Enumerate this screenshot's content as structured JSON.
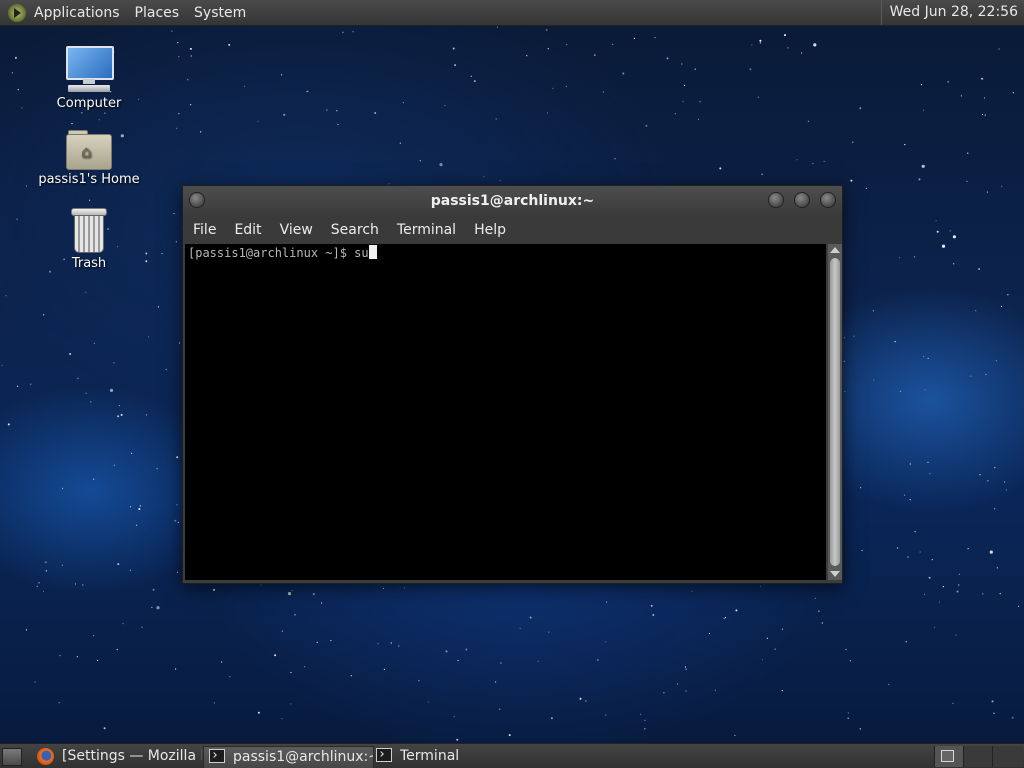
{
  "top_panel": {
    "menus": [
      "Applications",
      "Places",
      "System"
    ],
    "clock": "Wed Jun 28, 22:56"
  },
  "desktop": {
    "icons": [
      {
        "label": "Computer",
        "icon": "computer-icon"
      },
      {
        "label": "passis1's Home",
        "icon": "home-folder-icon"
      },
      {
        "label": "Trash",
        "icon": "trash-icon"
      }
    ]
  },
  "terminal_window": {
    "title": "passis1@archlinux:~",
    "menus": [
      "File",
      "Edit",
      "View",
      "Search",
      "Terminal",
      "Help"
    ],
    "prompt": "[passis1@archlinux ~]$ ",
    "command": "su"
  },
  "taskbar": {
    "tasks": [
      {
        "label": "[Settings — Mozilla Fi...",
        "icon": "firefox-icon",
        "active": false
      },
      {
        "label": "passis1@archlinux:~",
        "icon": "terminal-icon",
        "active": true
      },
      {
        "label": "Terminal",
        "icon": "terminal-icon",
        "active": false
      }
    ]
  },
  "colors": {
    "panel": "#3c3c3c",
    "terminal_bg": "#000000",
    "terminal_fg": "#b8b8b8",
    "desktop_bg": "#0c2450"
  }
}
